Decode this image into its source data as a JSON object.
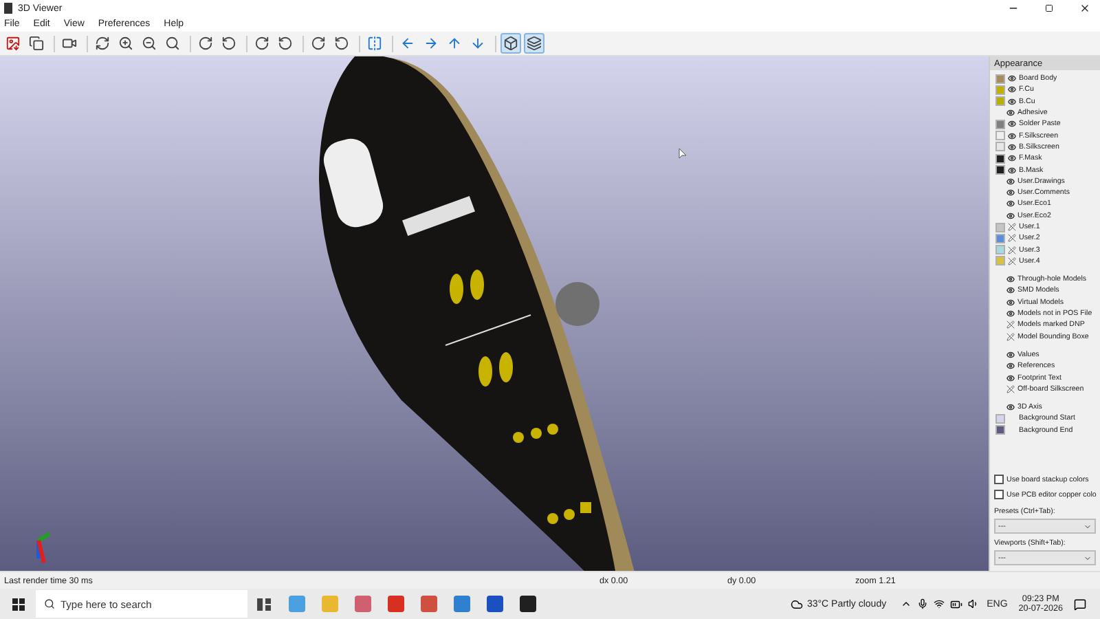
{
  "window": {
    "title": "3D Viewer"
  },
  "menu": [
    "File",
    "Edit",
    "View",
    "Preferences",
    "Help"
  ],
  "toolbar": [
    [
      {
        "kind": "save",
        "active": false
      },
      {
        "kind": "copy",
        "active": false
      }
    ],
    [
      {
        "kind": "raytrace-cam",
        "active": false
      }
    ],
    [
      {
        "kind": "reload",
        "active": false
      },
      {
        "kind": "zoom-in",
        "active": false
      },
      {
        "kind": "zoom-out",
        "active": false
      },
      {
        "kind": "zoom-fit",
        "active": false
      }
    ],
    [
      {
        "kind": "rot-cw",
        "active": false
      },
      {
        "kind": "rot-ccw",
        "active": false
      }
    ],
    [
      {
        "kind": "rot-cw",
        "active": false
      },
      {
        "kind": "rot-ccw",
        "active": false
      }
    ],
    [
      {
        "kind": "rot-cw",
        "active": false
      },
      {
        "kind": "rot-ccw",
        "active": false
      }
    ],
    [
      {
        "kind": "flip",
        "active": false
      }
    ],
    [
      {
        "kind": "left",
        "active": false
      },
      {
        "kind": "right",
        "active": false
      },
      {
        "kind": "up",
        "active": false
      },
      {
        "kind": "down",
        "active": false
      }
    ],
    [
      {
        "kind": "box",
        "active": true
      },
      {
        "kind": "layers",
        "active": true
      }
    ]
  ],
  "appearance": {
    "title": "Appearance",
    "groups": [
      [
        {
          "name": "Board Body",
          "color": "#a48c5c",
          "visible": true
        },
        {
          "name": "F.Cu",
          "color": "#c0b000",
          "visible": true
        },
        {
          "name": "B.Cu",
          "color": "#b8b000",
          "visible": true
        },
        {
          "name": "Adhesive",
          "visible": true
        },
        {
          "name": "Solder Paste",
          "color": "#808080",
          "visible": true
        },
        {
          "name": "F.Silkscreen",
          "color": "#eeeeee",
          "visible": true
        },
        {
          "name": "B.Silkscreen",
          "color": "#e6e6e6",
          "visible": true
        },
        {
          "name": "F.Mask",
          "color": "#202020",
          "visible": true
        },
        {
          "name": "B.Mask",
          "color": "#202020",
          "visible": true
        },
        {
          "name": "User.Drawings",
          "visible": true
        },
        {
          "name": "User.Comments",
          "visible": true
        },
        {
          "name": "User.Eco1",
          "visible": true
        },
        {
          "name": "User.Eco2",
          "visible": true
        },
        {
          "name": "User.1",
          "color": "#c4c4c4",
          "visible": false
        },
        {
          "name": "User.2",
          "color": "#5b8fd9",
          "visible": false
        },
        {
          "name": "User.3",
          "color": "#a8d8e0",
          "visible": false
        },
        {
          "name": "User.4",
          "color": "#d8c040",
          "visible": false
        }
      ],
      [
        {
          "name": "Through-hole Models",
          "visible": true
        },
        {
          "name": "SMD Models",
          "visible": true
        },
        {
          "name": "Virtual Models",
          "visible": true
        },
        {
          "name": "Models not in POS File",
          "visible": true
        },
        {
          "name": "Models marked DNP",
          "visible": false
        },
        {
          "name": "Model Bounding Boxe",
          "visible": false
        }
      ],
      [
        {
          "name": "Values",
          "visible": true
        },
        {
          "name": "References",
          "visible": true
        },
        {
          "name": "Footprint Text",
          "visible": true
        },
        {
          "name": "Off-board Silkscreen",
          "visible": false
        }
      ],
      [
        {
          "name": "3D Axis",
          "visible": true
        },
        {
          "name": "Background Start",
          "color": "#d4d4ec"
        },
        {
          "name": "Background End",
          "color": "#5c5c80"
        }
      ]
    ],
    "options": [
      {
        "label": "Use board stackup colors",
        "checked": false
      },
      {
        "label": "Use PCB editor copper colo",
        "checked": false
      }
    ],
    "selects": [
      {
        "label": "Presets (Ctrl+Tab):",
        "value": "---"
      },
      {
        "label": "Viewports (Shift+Tab):",
        "value": "---"
      }
    ]
  },
  "status_bar": {
    "message": "Last render time 30 ms",
    "dx": "dx 0.00",
    "dy": "dy 0.00",
    "zoom": "zoom 1.21"
  },
  "taskbar": {
    "search_placeholder": "Type here to search",
    "weather": "33°C  Partly cloudy",
    "language": "ENG",
    "time": "09:23 PM",
    "date": "20-07-2026"
  }
}
